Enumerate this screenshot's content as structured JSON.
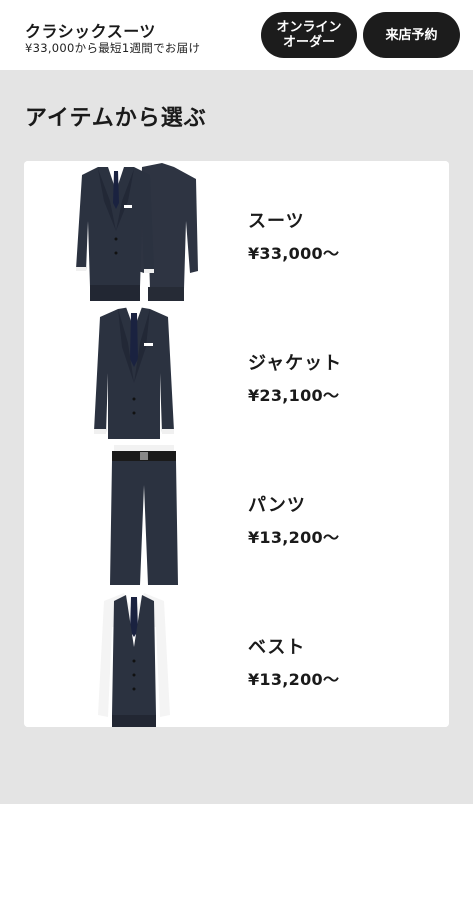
{
  "header": {
    "title": "クラシックスーツ",
    "subtitle": "¥33,000から最短1週間でお届け",
    "online_order_label": "オンライン\nオーダー",
    "store_reserve_label": "来店予約"
  },
  "main": {
    "section_title": "アイテムから選ぶ",
    "items": [
      {
        "name": "スーツ",
        "price": "¥33,000〜",
        "image_icon": "suit-image"
      },
      {
        "name": "ジャケット",
        "price": "¥23,100〜",
        "image_icon": "jacket-image"
      },
      {
        "name": "パンツ",
        "price": "¥13,200〜",
        "image_icon": "pants-image"
      },
      {
        "name": "ベスト",
        "price": "¥13,200〜",
        "image_icon": "vest-image"
      }
    ]
  },
  "colors": {
    "button_bg": "#1c1c1c",
    "page_bg": "#e4e4e4",
    "fabric": "#2b3240"
  }
}
